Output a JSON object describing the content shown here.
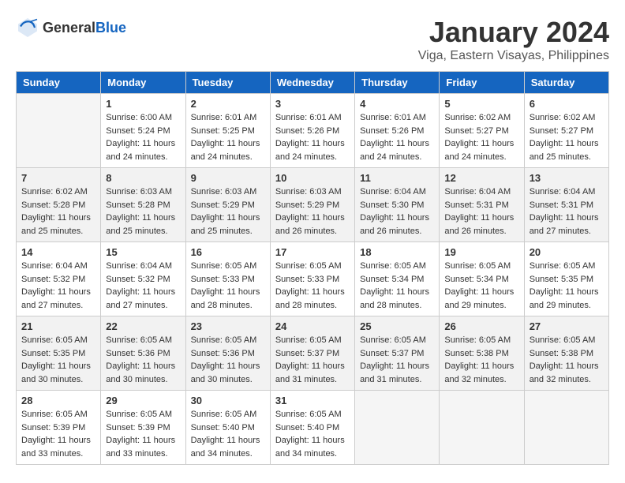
{
  "logo": {
    "general": "General",
    "blue": "Blue"
  },
  "title": "January 2024",
  "location": "Viga, Eastern Visayas, Philippines",
  "days_of_week": [
    "Sunday",
    "Monday",
    "Tuesday",
    "Wednesday",
    "Thursday",
    "Friday",
    "Saturday"
  ],
  "weeks": [
    [
      {
        "day": "",
        "info": ""
      },
      {
        "day": "1",
        "info": "Sunrise: 6:00 AM\nSunset: 5:24 PM\nDaylight: 11 hours\nand 24 minutes."
      },
      {
        "day": "2",
        "info": "Sunrise: 6:01 AM\nSunset: 5:25 PM\nDaylight: 11 hours\nand 24 minutes."
      },
      {
        "day": "3",
        "info": "Sunrise: 6:01 AM\nSunset: 5:26 PM\nDaylight: 11 hours\nand 24 minutes."
      },
      {
        "day": "4",
        "info": "Sunrise: 6:01 AM\nSunset: 5:26 PM\nDaylight: 11 hours\nand 24 minutes."
      },
      {
        "day": "5",
        "info": "Sunrise: 6:02 AM\nSunset: 5:27 PM\nDaylight: 11 hours\nand 24 minutes."
      },
      {
        "day": "6",
        "info": "Sunrise: 6:02 AM\nSunset: 5:27 PM\nDaylight: 11 hours\nand 25 minutes."
      }
    ],
    [
      {
        "day": "7",
        "info": "Sunrise: 6:02 AM\nSunset: 5:28 PM\nDaylight: 11 hours\nand 25 minutes."
      },
      {
        "day": "8",
        "info": "Sunrise: 6:03 AM\nSunset: 5:28 PM\nDaylight: 11 hours\nand 25 minutes."
      },
      {
        "day": "9",
        "info": "Sunrise: 6:03 AM\nSunset: 5:29 PM\nDaylight: 11 hours\nand 25 minutes."
      },
      {
        "day": "10",
        "info": "Sunrise: 6:03 AM\nSunset: 5:29 PM\nDaylight: 11 hours\nand 26 minutes."
      },
      {
        "day": "11",
        "info": "Sunrise: 6:04 AM\nSunset: 5:30 PM\nDaylight: 11 hours\nand 26 minutes."
      },
      {
        "day": "12",
        "info": "Sunrise: 6:04 AM\nSunset: 5:31 PM\nDaylight: 11 hours\nand 26 minutes."
      },
      {
        "day": "13",
        "info": "Sunrise: 6:04 AM\nSunset: 5:31 PM\nDaylight: 11 hours\nand 27 minutes."
      }
    ],
    [
      {
        "day": "14",
        "info": "Sunrise: 6:04 AM\nSunset: 5:32 PM\nDaylight: 11 hours\nand 27 minutes."
      },
      {
        "day": "15",
        "info": "Sunrise: 6:04 AM\nSunset: 5:32 PM\nDaylight: 11 hours\nand 27 minutes."
      },
      {
        "day": "16",
        "info": "Sunrise: 6:05 AM\nSunset: 5:33 PM\nDaylight: 11 hours\nand 28 minutes."
      },
      {
        "day": "17",
        "info": "Sunrise: 6:05 AM\nSunset: 5:33 PM\nDaylight: 11 hours\nand 28 minutes."
      },
      {
        "day": "18",
        "info": "Sunrise: 6:05 AM\nSunset: 5:34 PM\nDaylight: 11 hours\nand 28 minutes."
      },
      {
        "day": "19",
        "info": "Sunrise: 6:05 AM\nSunset: 5:34 PM\nDaylight: 11 hours\nand 29 minutes."
      },
      {
        "day": "20",
        "info": "Sunrise: 6:05 AM\nSunset: 5:35 PM\nDaylight: 11 hours\nand 29 minutes."
      }
    ],
    [
      {
        "day": "21",
        "info": "Sunrise: 6:05 AM\nSunset: 5:35 PM\nDaylight: 11 hours\nand 30 minutes."
      },
      {
        "day": "22",
        "info": "Sunrise: 6:05 AM\nSunset: 5:36 PM\nDaylight: 11 hours\nand 30 minutes."
      },
      {
        "day": "23",
        "info": "Sunrise: 6:05 AM\nSunset: 5:36 PM\nDaylight: 11 hours\nand 30 minutes."
      },
      {
        "day": "24",
        "info": "Sunrise: 6:05 AM\nSunset: 5:37 PM\nDaylight: 11 hours\nand 31 minutes."
      },
      {
        "day": "25",
        "info": "Sunrise: 6:05 AM\nSunset: 5:37 PM\nDaylight: 11 hours\nand 31 minutes."
      },
      {
        "day": "26",
        "info": "Sunrise: 6:05 AM\nSunset: 5:38 PM\nDaylight: 11 hours\nand 32 minutes."
      },
      {
        "day": "27",
        "info": "Sunrise: 6:05 AM\nSunset: 5:38 PM\nDaylight: 11 hours\nand 32 minutes."
      }
    ],
    [
      {
        "day": "28",
        "info": "Sunrise: 6:05 AM\nSunset: 5:39 PM\nDaylight: 11 hours\nand 33 minutes."
      },
      {
        "day": "29",
        "info": "Sunrise: 6:05 AM\nSunset: 5:39 PM\nDaylight: 11 hours\nand 33 minutes."
      },
      {
        "day": "30",
        "info": "Sunrise: 6:05 AM\nSunset: 5:40 PM\nDaylight: 11 hours\nand 34 minutes."
      },
      {
        "day": "31",
        "info": "Sunrise: 6:05 AM\nSunset: 5:40 PM\nDaylight: 11 hours\nand 34 minutes."
      },
      {
        "day": "",
        "info": ""
      },
      {
        "day": "",
        "info": ""
      },
      {
        "day": "",
        "info": ""
      }
    ]
  ]
}
